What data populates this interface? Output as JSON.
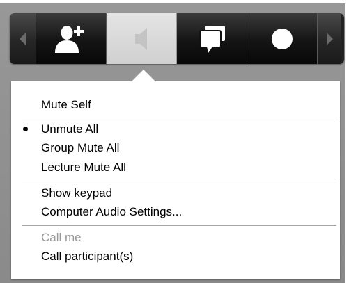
{
  "toolbar": {
    "buttons": [
      {
        "icon": "chevron-left-icon"
      },
      {
        "icon": "add-user-icon"
      },
      {
        "icon": "speaker-icon",
        "active": true
      },
      {
        "icon": "chat-icon"
      },
      {
        "icon": "record-icon"
      },
      {
        "icon": "chevron-right-icon"
      }
    ]
  },
  "menu": {
    "mute_self": "Mute Self",
    "unmute_all": "Unmute All",
    "group_mute_all": "Group Mute All",
    "lecture_mute_all": "Lecture Mute All",
    "show_keypad": "Show keypad",
    "computer_audio_settings": "Computer Audio Settings...",
    "call_me": "Call me",
    "call_participants": "Call participant(s)",
    "selected_item": "Unmute All"
  }
}
